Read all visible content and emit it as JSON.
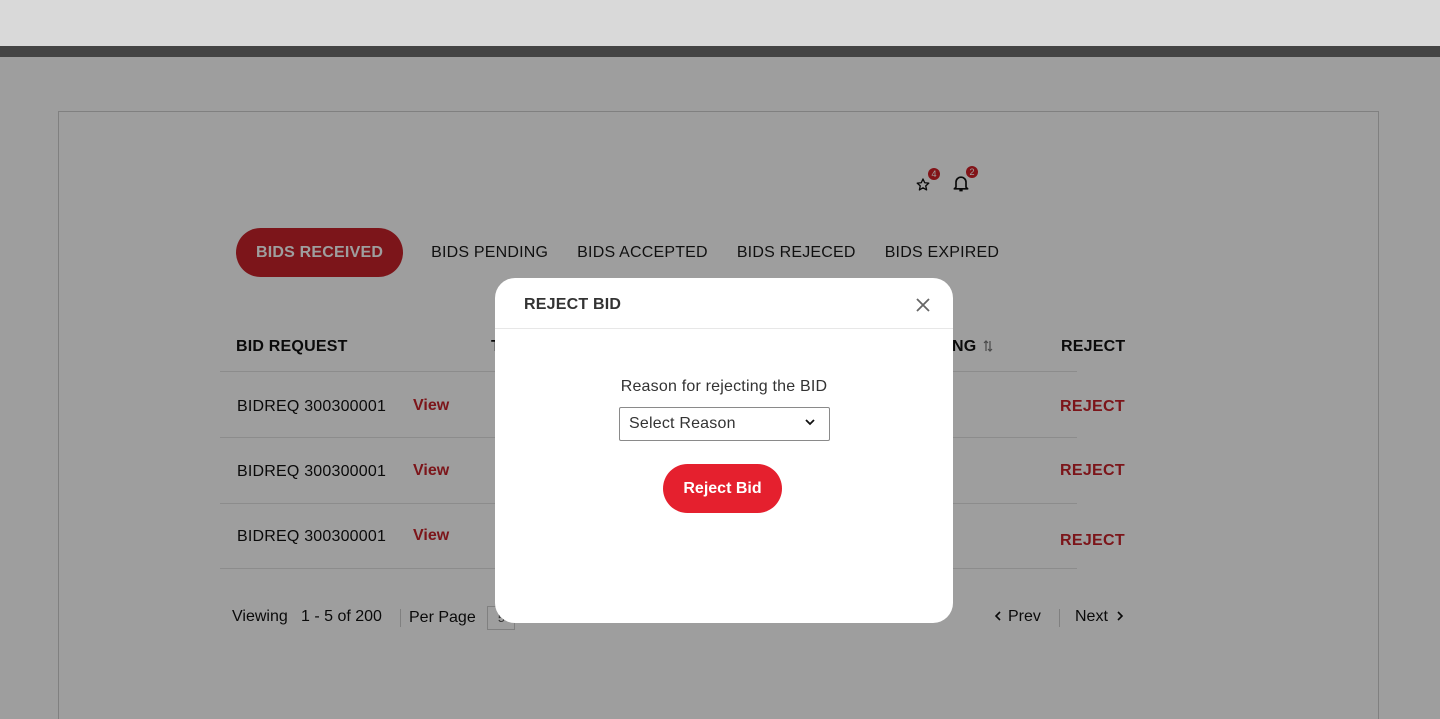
{
  "header": {
    "favorites_count": "4",
    "notifications_count": "2"
  },
  "tabs": [
    {
      "label": "BIDS RECEIVED",
      "active": true
    },
    {
      "label": "BIDS PENDING"
    },
    {
      "label": "BIDS ACCEPTED"
    },
    {
      "label": "BIDS REJECED"
    },
    {
      "label": "BIDS EXPIRED"
    }
  ],
  "table": {
    "headers": {
      "bid_request": "BID REQUEST",
      "col2_partial": "T",
      "col_rating_partial": "NG",
      "reject": "REJECT"
    },
    "rows": [
      {
        "id": "BIDREQ 300300001",
        "view": "View",
        "reject": "REJECT"
      },
      {
        "id": "BIDREQ 300300001",
        "view": "View",
        "reject": "REJECT"
      },
      {
        "id": "BIDREQ 300300001",
        "view": "View",
        "reject": "REJECT"
      }
    ]
  },
  "pagination": {
    "viewing_label": "Viewing",
    "range": "1 - 5 of 200",
    "per_page_label": "Per Page",
    "per_page_value": "5",
    "prev": "Prev",
    "next": "Next"
  },
  "modal": {
    "title": "REJECT BID",
    "reason_label": "Reason for rejecting the BID",
    "select_value": "Select Reason",
    "submit": "Reject Bid"
  },
  "colors": {
    "accent": "#c8232a",
    "button": "#e5202e"
  }
}
